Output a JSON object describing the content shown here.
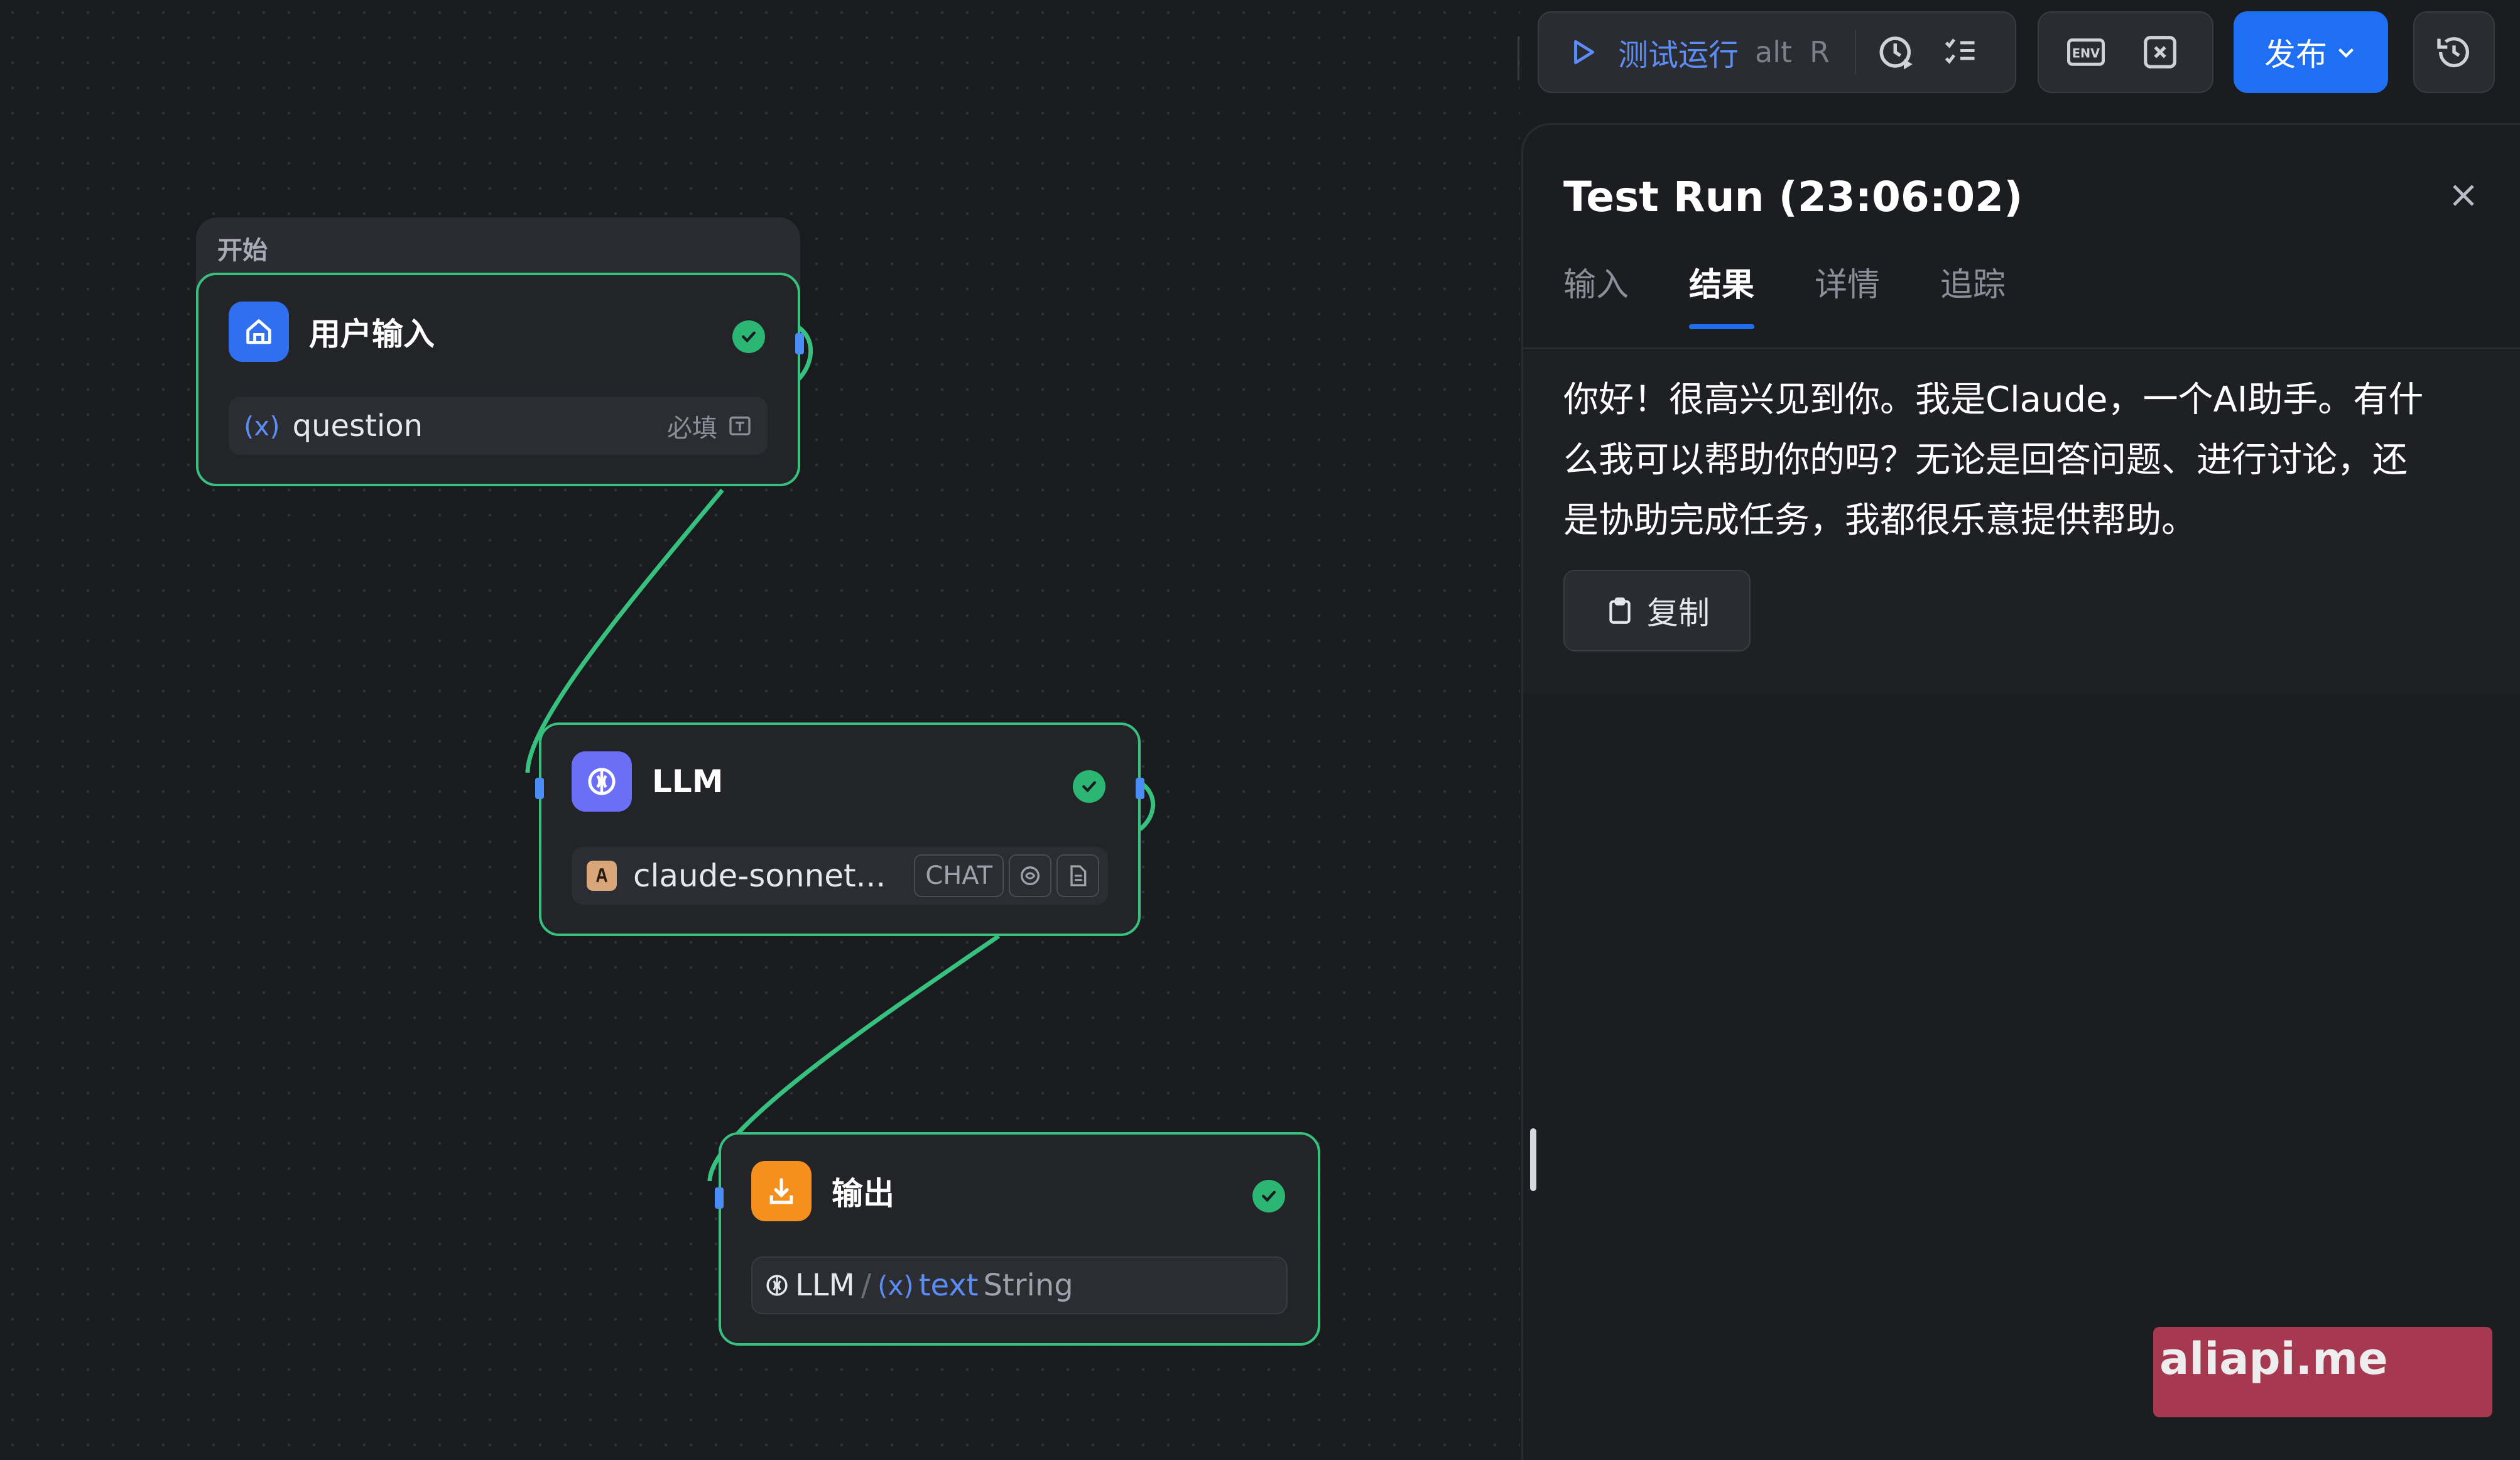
{
  "toolbar": {
    "test_run_label": "测试运行",
    "test_run_shortcut_mod": "alt",
    "test_run_shortcut_key": "R",
    "publish_label": "发布",
    "env_label": "ENV"
  },
  "nodes": {
    "start_group_label": "开始",
    "user_input": {
      "title": "用户输入",
      "param_icon": "(x)",
      "param_name": "question",
      "required_label": "必填"
    },
    "llm": {
      "title": "LLM",
      "model_name": "claude-sonnet...",
      "mode_tag": "CHAT"
    },
    "output": {
      "title": "输出",
      "source_node": "LLM",
      "separator": "/",
      "var_icon": "(x)",
      "var_name": "text",
      "var_type": "String"
    }
  },
  "panel": {
    "title": "Test Run (23:06:02)",
    "tabs": [
      "输入",
      "结果",
      "详情",
      "追踪"
    ],
    "active_tab": "结果",
    "result_line1": "你好！很高兴见到你。我是Claude，一个AI助手。有什",
    "result_line2": "么我可以帮助你的吗？无论是回答问题、进行讨论，还",
    "result_line3": "是协助完成任务，我都很乐意提供帮助。",
    "copy_label": "复制"
  },
  "watermark": "aliapi.me",
  "colors": {
    "accent": "#1f6ff2",
    "node_border": "#36c27e",
    "success": "#2bb673",
    "start_icon_bg": "#2f6ff0",
    "llm_icon_bg": "#6b6ff5",
    "output_icon_bg": "#f5901f"
  }
}
